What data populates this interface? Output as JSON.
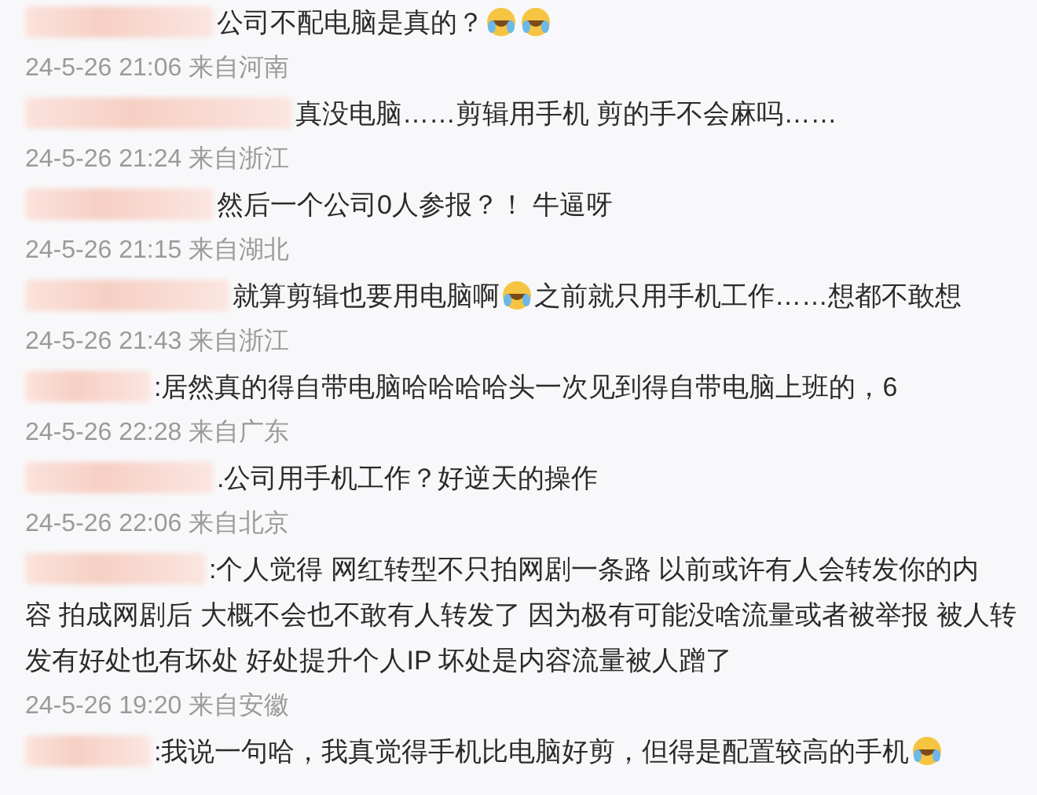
{
  "comments": [
    {
      "segments": [
        {
          "kind": "text",
          "text": "公司不配电脑是真的？"
        },
        {
          "kind": "emoji"
        },
        {
          "kind": "emoji"
        }
      ],
      "timestamp": "24-5-26 21:06 来自河南"
    },
    {
      "segments": [
        {
          "kind": "text",
          "text": "真没电脑……剪辑用手机  剪的手不会麻吗……"
        }
      ],
      "timestamp": "24-5-26 21:24 来自浙江"
    },
    {
      "segments": [
        {
          "kind": "text",
          "text": "然后一个公司0人参报？！ 牛逼呀"
        }
      ],
      "timestamp": "24-5-26 21:15 来自湖北"
    },
    {
      "segments": [
        {
          "kind": "text",
          "text": "就算剪辑也要用电脑啊"
        },
        {
          "kind": "emoji"
        },
        {
          "kind": "text",
          "text": "之前就只用手机工作……想都不敢想"
        }
      ],
      "timestamp": "24-5-26 21:43 来自浙江"
    },
    {
      "segments": [
        {
          "kind": "text",
          "text": ":居然真的得自带电脑哈哈哈哈头一次见到得自带电脑上班的，6"
        }
      ],
      "timestamp": "24-5-26 22:28 来自广东"
    },
    {
      "segments": [
        {
          "kind": "text",
          "text": ".公司用手机工作？好逆天的操作"
        }
      ],
      "timestamp": "24-5-26 22:06 来自北京"
    },
    {
      "segments": [
        {
          "kind": "text",
          "text": ":个人觉得 网红转型不只拍网剧一条路 以前或许有人会转发你的内"
        }
      ],
      "more_lines": [
        "容 拍成网剧后 大概不会也不敢有人转发了 因为极有可能没啥流量或者被举报 被人转",
        "发有好处也有坏处 好处提升个人IP 坏处是内容流量被人蹭了"
      ],
      "timestamp": "24-5-26 19:20 来自安徽"
    },
    {
      "segments": [
        {
          "kind": "text",
          "text": ":我说一句哈，我真觉得手机比电脑好剪，但得是配置较高的手机"
        },
        {
          "kind": "emoji"
        }
      ]
    }
  ]
}
